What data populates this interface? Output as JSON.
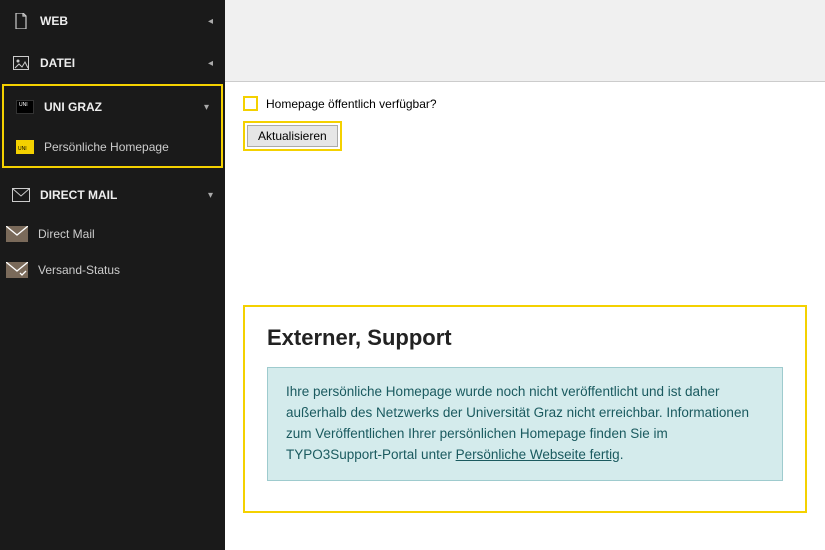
{
  "sidebar": {
    "web": {
      "label": "WEB"
    },
    "datei": {
      "label": "DATEI"
    },
    "unigraz": {
      "label": "UNI GRAZ"
    },
    "personal_hp": {
      "label": "Persönliche Homepage"
    },
    "direct_mail_header": {
      "label": "DIRECT MAIL"
    },
    "direct_mail": {
      "label": "Direct Mail"
    },
    "versand_status": {
      "label": "Versand-Status"
    }
  },
  "main": {
    "checkbox_label": "Homepage öffentlich verfügbar?",
    "button_update": "Aktualisieren",
    "support_title": "Externer, Support",
    "info_text_1": "Ihre persönliche Homepage wurde noch nicht veröffentlicht und ist daher außerhalb des Netzwerks der Universität Graz nicht erreichbar. Informationen zum Veröffentlichen Ihrer persönlichen Homepage finden Sie im TYPO3Support-Portal unter ",
    "info_link": "Persönliche Webseite fertig",
    "info_text_2": "."
  }
}
